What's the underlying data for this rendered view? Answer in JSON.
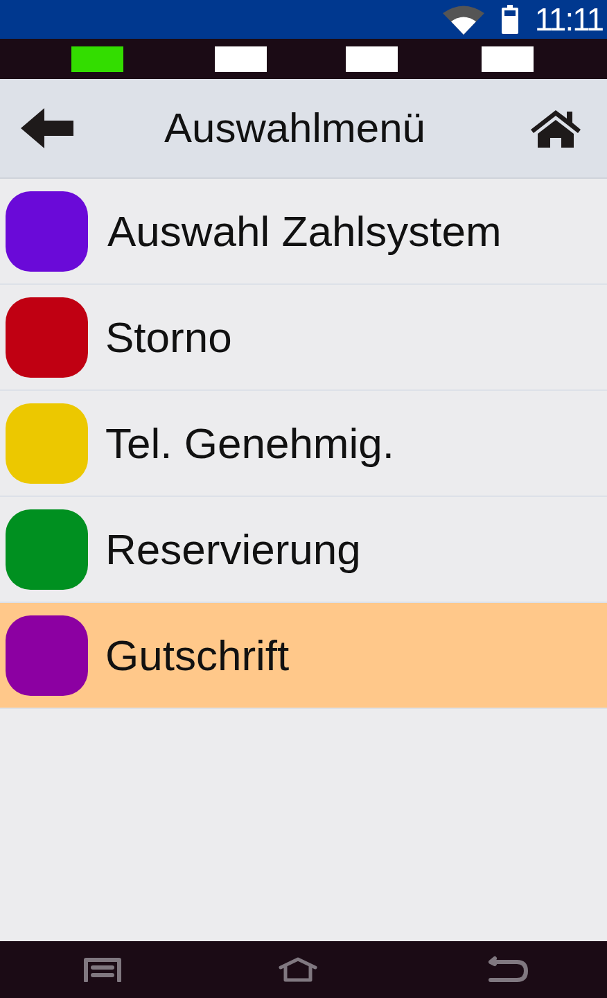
{
  "status_bar": {
    "time": "11:11"
  },
  "indicators": [
    {
      "active": true
    },
    {
      "active": false
    },
    {
      "active": false
    },
    {
      "active": false
    }
  ],
  "header": {
    "title": "Auswahlmenü"
  },
  "menu": {
    "items": [
      {
        "label": "Auswahl Zahlsystem",
        "color": "#6a0ad8",
        "selected": false
      },
      {
        "label": "Storno",
        "color": "#c00012",
        "selected": false
      },
      {
        "label": "Tel. Genehmig.",
        "color": "#ecc800",
        "selected": false
      },
      {
        "label": "Reservierung",
        "color": "#009020",
        "selected": false
      },
      {
        "label": "Gutschrift",
        "color": "#8c00a2",
        "selected": true
      }
    ]
  }
}
